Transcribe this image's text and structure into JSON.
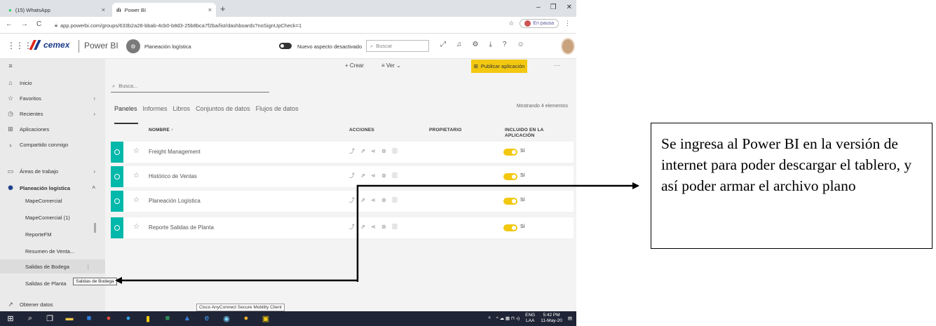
{
  "browser": {
    "tabs": [
      {
        "label": "(15) WhatsApp",
        "icon": "whatsapp-icon"
      },
      {
        "label": "Power BI",
        "icon": "powerbi-icon"
      }
    ],
    "url": "app.powerbi.com/groups/633b2a28-bbab-4cb0-b8d3-25b8bca7f2ba/list/dashboards?noSignUpCheck=1",
    "profile_status": "En pausa"
  },
  "header": {
    "company": "cemex",
    "brand": "Power BI",
    "workspace": "Planeación logística",
    "new_look_label": "Nuevo aspecto desactivado",
    "search_placeholder": "Buscar"
  },
  "actions": {
    "create": "+ Crear",
    "view": "Ver",
    "publish": "Publicar aplicación"
  },
  "sidebar": {
    "items": [
      {
        "label": "Inicio",
        "icon": "home-icon"
      },
      {
        "label": "Favoritos",
        "icon": "star-icon"
      },
      {
        "label": "Recientes",
        "icon": "clock-icon"
      },
      {
        "label": "Aplicaciones",
        "icon": "apps-icon"
      },
      {
        "label": "Compartido conmigo",
        "icon": "share-icon"
      },
      {
        "label": "Áreas de trabajo",
        "icon": "workspaces-icon"
      },
      {
        "label": "Planeación logística",
        "icon": "workspace-icon"
      }
    ],
    "sub_items": [
      "MapeComercial",
      "MapeComercial (1)",
      "ReporteFM",
      "Resumen de Venta...",
      "Salidas de Bodega",
      "Salidas de Planta"
    ],
    "footer": "Obtener datos",
    "tooltip": "Salidas de Bodega"
  },
  "main": {
    "search_placeholder": "Busca...",
    "tabs": [
      "Paneles",
      "Informes",
      "Libros",
      "Conjuntos de datos",
      "Flujos de datos"
    ],
    "count": "Mostrando 4 elementos",
    "columns": {
      "name": "NOMBRE ↑",
      "actions": "ACCIONES",
      "owner": "PROPIETARIO",
      "included": "INCLUIDO EN LA APLICACIÓN"
    },
    "rows": [
      {
        "name": "Freight Management",
        "included": "Sí"
      },
      {
        "name": "Histórico de Ventas",
        "included": "Sí"
      },
      {
        "name": "Planeación Logística",
        "included": "Sí"
      },
      {
        "name": "Reporte Salidas de Planta",
        "included": "Sí"
      }
    ]
  },
  "taskbar": {
    "tooltip": "Cisco AnyConnect Secure Mobility Client",
    "lang": "ENG",
    "region": "LAA",
    "time": "5:42 PM",
    "date": "11-May-20"
  },
  "annotation": {
    "text": "Se ingresa al Power BI en la versión de internet para poder descargar el tablero, y así poder armar el archivo plano"
  }
}
